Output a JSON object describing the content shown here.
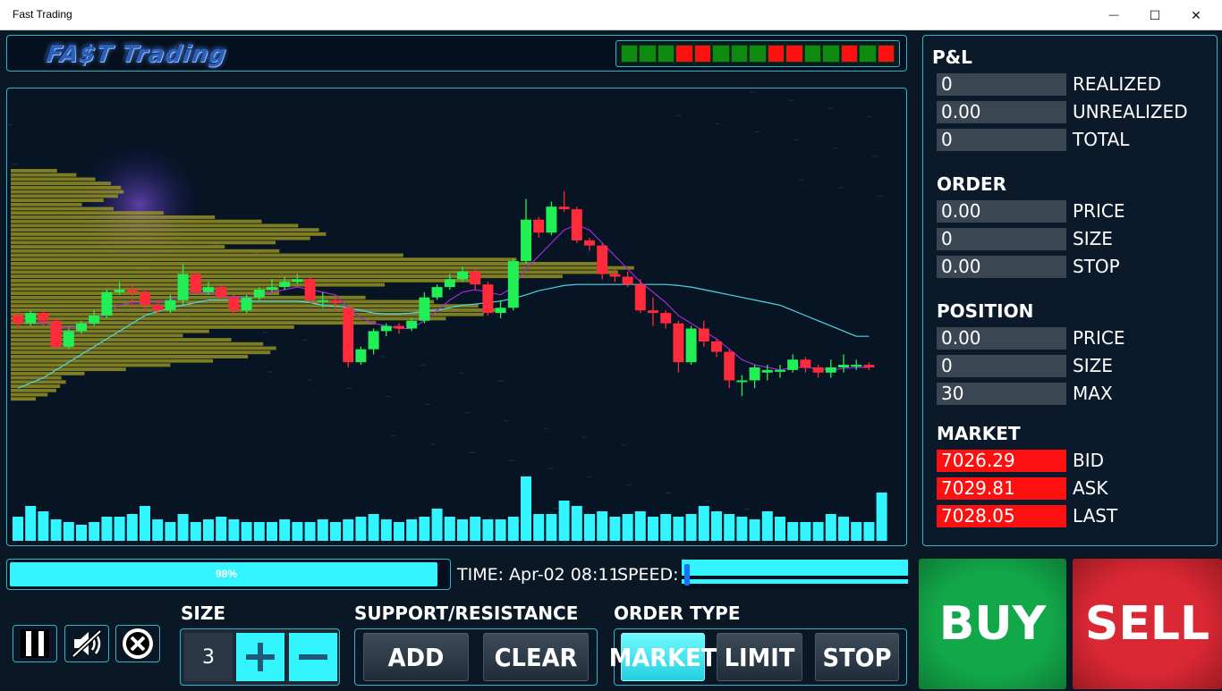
{
  "window": {
    "title": "Fast Trading",
    "minimize_glyph": "—",
    "maximize_glyph": "☐",
    "close_glyph": "✕"
  },
  "app": {
    "logo_text": "FA$T Trading"
  },
  "trend_strip": [
    "green",
    "green",
    "green",
    "red",
    "red",
    "green",
    "green",
    "green",
    "red",
    "red",
    "green",
    "green",
    "red",
    "green",
    "red"
  ],
  "colors": {
    "accent": "#33f5ff",
    "up": "#22ee55",
    "down": "#ff2a3a",
    "buy": "#12a84a",
    "sell": "#d92834",
    "profile": "#a8a020"
  },
  "pnl": {
    "heading": "P&L",
    "rows": [
      {
        "value": "0",
        "label": "REALIZED"
      },
      {
        "value": "0.00",
        "label": "UNREALIZED"
      },
      {
        "value": "0",
        "label": "TOTAL"
      }
    ]
  },
  "order": {
    "heading": "ORDER",
    "rows": [
      {
        "value": "0.00",
        "label": "PRICE"
      },
      {
        "value": "0",
        "label": "SIZE"
      },
      {
        "value": "0.00",
        "label": "STOP"
      }
    ]
  },
  "position": {
    "heading": "POSITION",
    "rows": [
      {
        "value": "0.00",
        "label": "PRICE"
      },
      {
        "value": "0",
        "label": "SIZE"
      },
      {
        "value": "30",
        "label": "MAX"
      }
    ]
  },
  "market": {
    "heading": "MARKET",
    "rows": [
      {
        "value": "7026.29",
        "label": "BID"
      },
      {
        "value": "7029.81",
        "label": "ASK"
      },
      {
        "value": "7028.05",
        "label": "LAST"
      }
    ]
  },
  "progress": {
    "percent": 98,
    "label": "98%"
  },
  "time_label": "TIME: Apr-02 08:11",
  "speed_label": "SPEED:",
  "speed_value": 0.01,
  "controls": {
    "pause_icon": "pause-icon",
    "mute_icon": "mute-icon",
    "exit_icon": "close-circle-icon"
  },
  "size": {
    "label": "SIZE",
    "value": "3",
    "plus": "+",
    "minus": "−"
  },
  "support_resistance": {
    "label": "SUPPORT/RESISTANCE",
    "add": "ADD",
    "clear": "CLEAR"
  },
  "order_type": {
    "label": "ORDER TYPE",
    "market": "MARKET",
    "limit": "LIMIT",
    "stop": "STOP",
    "selected": "MARKET"
  },
  "trade": {
    "buy": "BUY",
    "sell": "SELL"
  },
  "chart_data": {
    "type": "candlestick",
    "title": "",
    "grid": false,
    "candles": [
      [
        50.0,
        48.5,
        51.0,
        47.5
      ],
      [
        48.5,
        50.5,
        51.0,
        48.0
      ],
      [
        50.5,
        49.0,
        51.0,
        48.0
      ],
      [
        49.0,
        44.0,
        49.5,
        43.5
      ],
      [
        44.0,
        47.0,
        47.5,
        43.5
      ],
      [
        47.0,
        48.5,
        49.0,
        46.5
      ],
      [
        48.5,
        50.0,
        51.0,
        48.0
      ],
      [
        50.0,
        54.5,
        55.0,
        49.5
      ],
      [
        54.5,
        55.0,
        56.5,
        54.0
      ],
      [
        55.0,
        54.5,
        56.0,
        51.5
      ],
      [
        54.5,
        52.0,
        55.0,
        51.0
      ],
      [
        52.0,
        51.0,
        53.0,
        50.5
      ],
      [
        51.0,
        53.0,
        54.0,
        50.5
      ],
      [
        53.0,
        58.0,
        60.0,
        52.0
      ],
      [
        58.0,
        54.5,
        58.5,
        54.0
      ],
      [
        54.5,
        55.5,
        56.5,
        54.0
      ],
      [
        55.5,
        53.5,
        56.0,
        53.0
      ],
      [
        53.5,
        51.0,
        54.0,
        50.0
      ],
      [
        51.0,
        53.5,
        54.0,
        50.5
      ],
      [
        53.5,
        55.0,
        55.5,
        53.0
      ],
      [
        55.0,
        55.5,
        57.0,
        54.5
      ],
      [
        55.5,
        56.5,
        57.5,
        55.0
      ],
      [
        56.5,
        57.0,
        58.0,
        56.0
      ],
      [
        57.0,
        53.0,
        57.5,
        52.5
      ],
      [
        53.0,
        53.0,
        54.5,
        51.5
      ],
      [
        53.0,
        52.5,
        53.5,
        51.0
      ],
      [
        51.5,
        41.0,
        51.0,
        40.0
      ],
      [
        41.0,
        43.5,
        44.0,
        40.5
      ],
      [
        43.5,
        47.0,
        47.5,
        42.5
      ],
      [
        47.0,
        48.0,
        48.5,
        46.0
      ],
      [
        48.0,
        47.5,
        48.5,
        46.5
      ],
      [
        47.5,
        49.0,
        49.5,
        47.0
      ],
      [
        49.0,
        53.5,
        54.5,
        48.5
      ],
      [
        53.5,
        55.5,
        56.0,
        53.0
      ],
      [
        55.5,
        57.0,
        58.0,
        55.0
      ],
      [
        57.0,
        58.5,
        59.5,
        56.5
      ],
      [
        58.5,
        56.0,
        59.0,
        55.0
      ],
      [
        56.0,
        50.5,
        56.5,
        50.0
      ],
      [
        50.5,
        51.5,
        53.0,
        49.5
      ],
      [
        51.5,
        60.5,
        61.0,
        51.0
      ],
      [
        60.5,
        68.5,
        72.5,
        60.0
      ],
      [
        68.5,
        66.0,
        69.0,
        65.0
      ],
      [
        66.0,
        71.0,
        72.0,
        65.5
      ],
      [
        71.0,
        70.5,
        74.0,
        70.0
      ],
      [
        70.5,
        64.5,
        71.0,
        64.0
      ],
      [
        64.5,
        63.5,
        65.0,
        62.5
      ],
      [
        63.5,
        58.0,
        64.0,
        57.0
      ],
      [
        58.0,
        57.5,
        59.0,
        56.5
      ],
      [
        57.5,
        56.0,
        58.5,
        55.5
      ],
      [
        56.0,
        51.0,
        57.0,
        50.5
      ],
      [
        51.0,
        50.5,
        53.5,
        48.0
      ],
      [
        50.5,
        48.5,
        51.0,
        47.5
      ],
      [
        48.5,
        41.0,
        49.0,
        39.0
      ],
      [
        41.0,
        47.5,
        48.0,
        40.5
      ],
      [
        47.5,
        45.0,
        49.0,
        44.0
      ],
      [
        45.0,
        43.0,
        45.5,
        42.0
      ],
      [
        43.0,
        37.5,
        43.5,
        36.0
      ],
      [
        37.5,
        37.5,
        38.5,
        34.5
      ],
      [
        37.5,
        40.0,
        40.5,
        36.0
      ],
      [
        39.0,
        39.5,
        40.5,
        37.5
      ],
      [
        39.5,
        39.5,
        40.5,
        38.0
      ],
      [
        39.5,
        41.5,
        42.5,
        39.0
      ],
      [
        41.5,
        40.0,
        42.0,
        39.0
      ],
      [
        40.0,
        39.0,
        40.5,
        38.0
      ],
      [
        39.0,
        40.0,
        41.5,
        38.0
      ],
      [
        40.0,
        40.5,
        42.5,
        39.0
      ],
      [
        40.5,
        40.5,
        41.5,
        39.5
      ],
      [
        40.5,
        40.0,
        41.0,
        39.5
      ]
    ],
    "ma_fast": [
      49.5,
      49.0,
      48.5,
      48.0,
      47.5,
      48.0,
      49.0,
      50.5,
      52.0,
      52.5,
      52.5,
      52.5,
      53.0,
      54.0,
      54.5,
      54.5,
      54.0,
      53.5,
      53.5,
      54.0,
      54.5,
      55.0,
      55.5,
      55.0,
      54.5,
      54.0,
      51.5,
      49.5,
      48.5,
      48.0,
      47.5,
      47.5,
      49.0,
      51.0,
      53.0,
      54.5,
      55.0,
      54.5,
      54.0,
      55.5,
      59.0,
      61.5,
      64.0,
      66.5,
      67.5,
      66.5,
      64.0,
      61.5,
      59.0,
      56.5,
      54.5,
      52.5,
      50.0,
      48.5,
      47.0,
      45.5,
      43.5,
      41.5,
      40.5,
      40.0,
      39.5,
      40.0,
      40.0,
      39.8,
      39.5,
      39.8,
      40.0,
      40.0
    ],
    "ma_slow": [
      36.0,
      37.0,
      38.0,
      39.5,
      41.0,
      42.5,
      44.0,
      45.5,
      47.0,
      48.5,
      50.0,
      50.8,
      51.5,
      52.0,
      52.5,
      53.0,
      53.0,
      53.0,
      52.8,
      52.8,
      52.8,
      52.8,
      52.8,
      52.5,
      52.0,
      51.8,
      51.5,
      51.0,
      50.5,
      50.3,
      50.3,
      50.5,
      50.8,
      51.0,
      51.5,
      52.0,
      52.2,
      52.5,
      52.8,
      53.3,
      54.0,
      54.8,
      55.3,
      55.8,
      56.0,
      56.0,
      56.0,
      56.0,
      56.0,
      56.0,
      56.0,
      56.0,
      55.8,
      55.5,
      55.0,
      54.5,
      54.0,
      53.5,
      53.0,
      52.5,
      52.0,
      51.0,
      50.0,
      49.0,
      48.0,
      47.0,
      46.0,
      46.0
    ],
    "volume": [
      9,
      13,
      11,
      8,
      7,
      6,
      7,
      9,
      9,
      10,
      13,
      8,
      7,
      10,
      7,
      8,
      9,
      8,
      7,
      7,
      7,
      8,
      7,
      7,
      8,
      7,
      8,
      9,
      10,
      8,
      7,
      8,
      9,
      12,
      9,
      8,
      9,
      8,
      8,
      9,
      24,
      10,
      10,
      15,
      13,
      10,
      11,
      9,
      10,
      11,
      9,
      10,
      9,
      10,
      13,
      11,
      10,
      9,
      8,
      11,
      9,
      7,
      7,
      7,
      10,
      9,
      7,
      7,
      18
    ],
    "volume_max": 24,
    "volume_profile": [
      10,
      12,
      14,
      16,
      18,
      20,
      22,
      24,
      26,
      30,
      34,
      38,
      42,
      46,
      50,
      55,
      60,
      66,
      74,
      82,
      90,
      96,
      100,
      100,
      98,
      95,
      92,
      90,
      88,
      86,
      84,
      82,
      80,
      78,
      76,
      74,
      70,
      66,
      62,
      58,
      54,
      50,
      46,
      42,
      38,
      34,
      30,
      26,
      22,
      18,
      14,
      10,
      8,
      6,
      4
    ],
    "y_range": [
      30,
      80
    ]
  }
}
